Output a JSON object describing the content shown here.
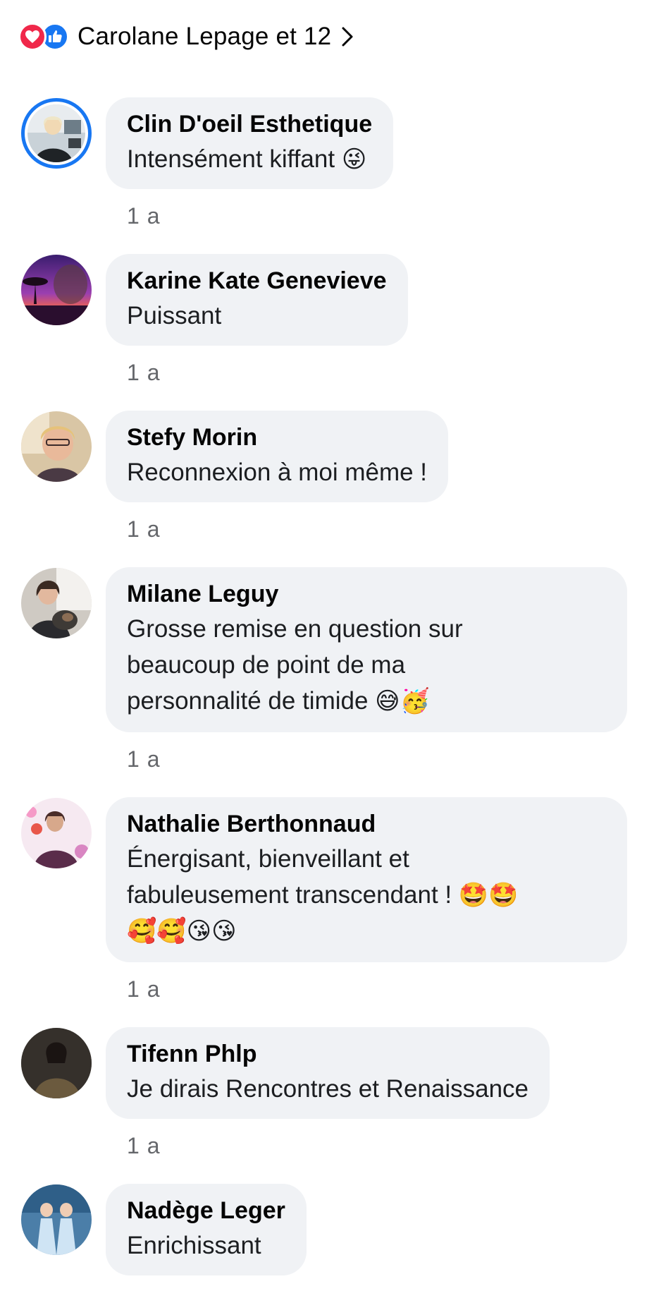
{
  "reactions": {
    "label": "Carolane Lepage et 12",
    "icons": [
      "heart-icon",
      "like-icon"
    ],
    "colors": {
      "heart": "#f0284a",
      "like": "#1877f2"
    }
  },
  "comments": [
    {
      "author": "Clin D'oeil Esthetique",
      "text": "Intensément kiffant",
      "emoji": "😜",
      "time": "1 a"
    },
    {
      "author": "Karine Kate Genevieve",
      "text": "Puissant",
      "time": "1 a"
    },
    {
      "author": "Stefy Morin",
      "text": "Reconnexion à moi même !",
      "time": "1 a"
    },
    {
      "author": "Milane Leguy",
      "text_lines": [
        "Grosse remise en question sur",
        "beaucoup de point de ma",
        "personnalité de timide"
      ],
      "emoji": "😅🥳",
      "time": "1 a"
    },
    {
      "author": "Nathalie Berthonnaud",
      "text_lines": [
        "Énergisant, bienveillant et",
        "fabuleusement transcendant !"
      ],
      "emoji": "🤩🤩",
      "emoji_line": "🥰🥰😘😘",
      "time": "1 a"
    },
    {
      "author": "Tifenn Phlp",
      "text": "Je dirais Rencontres et Renaissance",
      "time": "1 a"
    },
    {
      "author": "Nadège Leger",
      "text": "Enrichissant"
    }
  ]
}
